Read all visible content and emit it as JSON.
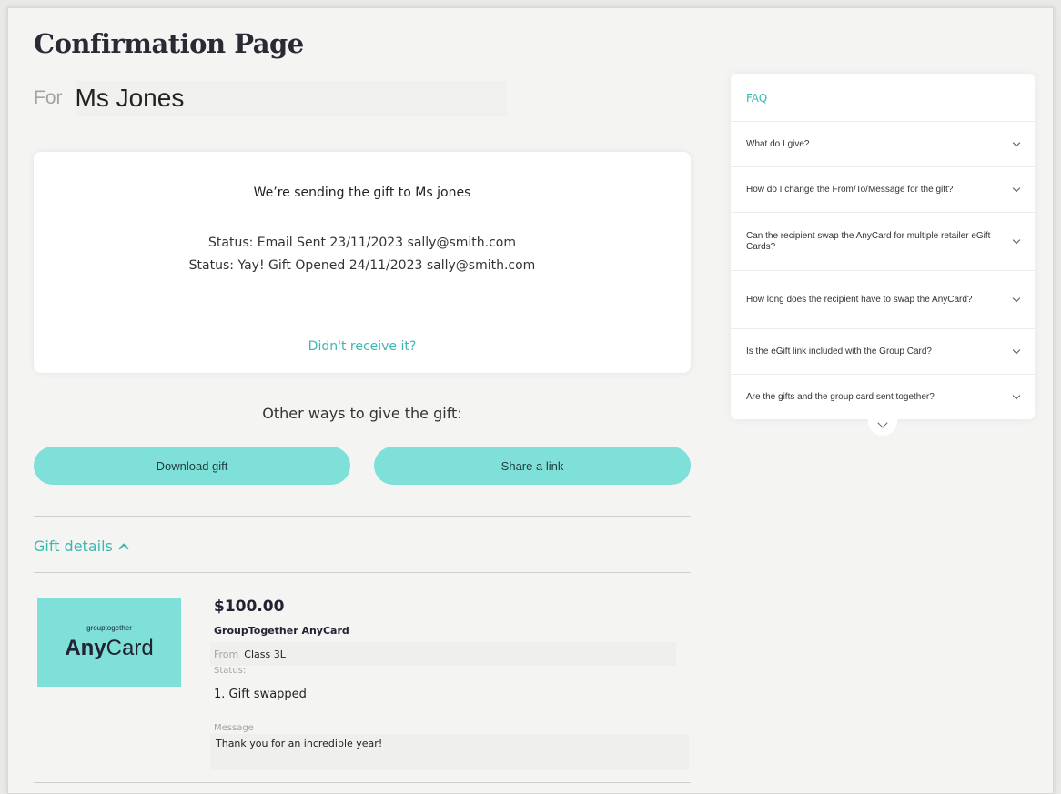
{
  "page": {
    "title": "Confirmation Page",
    "for_label": "For",
    "recipient_name": "Ms Jones"
  },
  "status_card": {
    "headline": "We’re sending the gift to Ms jones",
    "status_lines": [
      "Status: Email Sent 23/11/2023 sally@smith.com",
      "Status: Yay! Gift Opened 24/11/2023 sally@smith.com"
    ],
    "resend_link": "Didn't receive it?"
  },
  "other_ways": {
    "heading": "Other ways to give the gift:",
    "download_label": "Download gift",
    "share_label": "Share a link"
  },
  "gift_details": {
    "toggle_label": "Gift details",
    "card_brand_small": "grouptogether",
    "card_brand_bold": "Any",
    "card_brand_rest": "Card",
    "price": "$100.00",
    "product_name": "GroupTogether AnyCard",
    "from_label": "From",
    "from_value": "Class 3L",
    "status_label": "Status:",
    "status_items": [
      "1.  Gift swapped"
    ],
    "message_label": "Message",
    "message_value": "Thank you for an incredible year!"
  },
  "faq": {
    "title": "FAQ",
    "items": [
      "What do I give?",
      "How do I change the From/To/Message for the gift?",
      "Can the recipient swap the AnyCard for multiple retailer eGift Cards?",
      "How long does the recipient have to swap the AnyCard?",
      "Is the eGift link included with the Group Card?",
      "Are the gifts and the group card sent together?"
    ]
  },
  "colors": {
    "accent": "#3bb8b0",
    "button_fill": "#7fe0da",
    "background": "#f4f4f3"
  }
}
